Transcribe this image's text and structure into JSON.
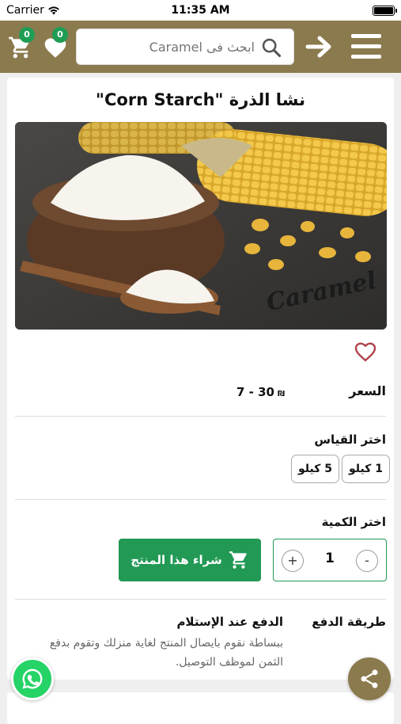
{
  "status": {
    "carrier": "Carrier",
    "time": "11:35 AM"
  },
  "header": {
    "cart_count": "0",
    "favorites_count": "0",
    "search_placeholder": "ابحث فى Caramel",
    "accent_color": "#8b7a4d"
  },
  "product": {
    "title": "نشا الذرة \"Corn Starch\"",
    "image_watermark": "Caramel",
    "price_label": "السعر",
    "price_range": "7 - 30",
    "currency": "₪"
  },
  "size": {
    "label": "اختر القياس",
    "options": [
      "1 كيلو",
      "5 كيلو"
    ]
  },
  "quantity": {
    "label": "اختر الكمية",
    "value": "1",
    "minus": "-",
    "plus": "+",
    "buy_label": "شراء هذا المنتج",
    "buy_color": "#229955"
  },
  "payment": {
    "label": "طريقة الدفع",
    "method_title": "الدفع عند الإستلام",
    "method_desc": "ببساطة نقوم بايصال المنتج لغاية منزلك وتقوم بدفع الثمن لموظف التوصيل."
  }
}
